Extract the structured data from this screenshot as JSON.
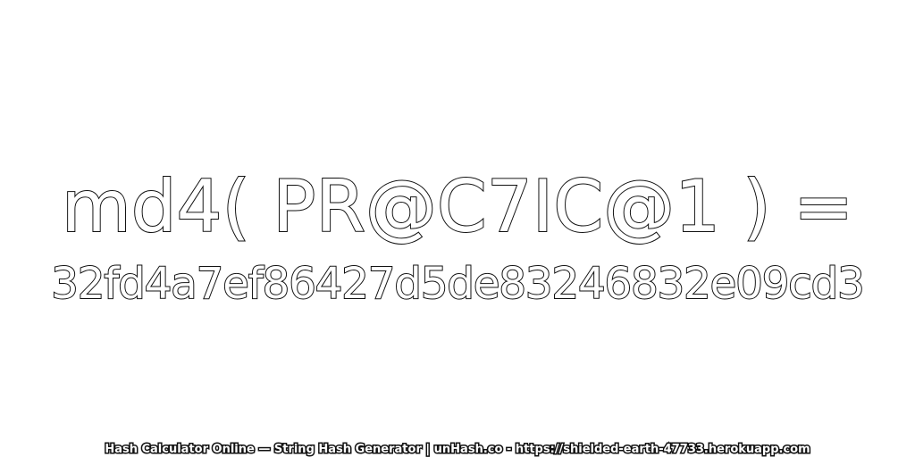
{
  "expression": "md4( PR@C7IC@1 ) =",
  "hash_value": "32fd4a7ef86427d5de83246832e09cd3",
  "footer": "Hash Calculator Online — String Hash Generator | unHash.co - https://shielded-earth-47733.herokuapp.com",
  "colors": {
    "background": "#ffffff",
    "text_outline": "#111111",
    "text_fill": "#ffffff"
  }
}
